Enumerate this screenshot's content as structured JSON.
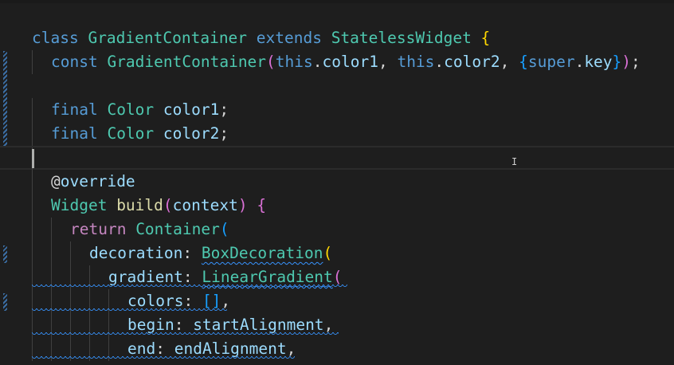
{
  "editor": {
    "lines": [
      {
        "tokens": [
          {
            "c": "k",
            "t": "class "
          },
          {
            "c": "t",
            "t": "GradientContainer "
          },
          {
            "c": "k",
            "t": "extends "
          },
          {
            "c": "t",
            "t": "StatelessWidget "
          },
          {
            "c": "b1",
            "t": "{"
          }
        ]
      },
      {
        "tokens": [
          {
            "c": "k",
            "t": "const "
          },
          {
            "c": "t",
            "t": "GradientContainer"
          },
          {
            "c": "b2",
            "t": "("
          },
          {
            "c": "k",
            "t": "this"
          },
          {
            "c": "p",
            "t": "."
          },
          {
            "c": "v",
            "t": "color1"
          },
          {
            "c": "p",
            "t": ", "
          },
          {
            "c": "k",
            "t": "this"
          },
          {
            "c": "p",
            "t": "."
          },
          {
            "c": "v",
            "t": "color2"
          },
          {
            "c": "p",
            "t": ", "
          },
          {
            "c": "b3",
            "t": "{"
          },
          {
            "c": "k",
            "t": "super"
          },
          {
            "c": "p",
            "t": "."
          },
          {
            "c": "v",
            "t": "key"
          },
          {
            "c": "b3",
            "t": "}"
          },
          {
            "c": "b2",
            "t": ")"
          },
          {
            "c": "p",
            "t": ";"
          }
        ]
      },
      {
        "tokens": []
      },
      {
        "tokens": [
          {
            "c": "k",
            "t": "final "
          },
          {
            "c": "t",
            "t": "Color "
          },
          {
            "c": "v",
            "t": "color1"
          },
          {
            "c": "p",
            "t": ";"
          }
        ]
      },
      {
        "tokens": [
          {
            "c": "k",
            "t": "final "
          },
          {
            "c": "t",
            "t": "Color "
          },
          {
            "c": "v",
            "t": "color2"
          },
          {
            "c": "p",
            "t": ";"
          }
        ]
      },
      {
        "tokens": []
      },
      {
        "tokens": [
          {
            "c": "p",
            "t": "@"
          },
          {
            "c": "v",
            "t": "override"
          }
        ]
      },
      {
        "tokens": [
          {
            "c": "t",
            "t": "Widget "
          },
          {
            "c": "f",
            "t": "build"
          },
          {
            "c": "b2",
            "t": "("
          },
          {
            "c": "v",
            "t": "context"
          },
          {
            "c": "b2",
            "t": ")"
          },
          {
            "c": "p",
            "t": " "
          },
          {
            "c": "b2",
            "t": "{"
          }
        ]
      },
      {
        "tokens": [
          {
            "c": "kp",
            "t": "return "
          },
          {
            "c": "t",
            "t": "Container"
          },
          {
            "c": "b3",
            "t": "("
          }
        ]
      },
      {
        "tokens": [
          {
            "c": "v",
            "t": "decoration"
          },
          {
            "c": "p",
            "t": ": "
          },
          {
            "c": "t squig",
            "t": "BoxDecoration"
          },
          {
            "c": "b1",
            "t": "("
          }
        ]
      },
      {
        "tokens": [
          {
            "c": "v",
            "t": "gradient"
          },
          {
            "c": "p",
            "t": ": "
          },
          {
            "c": "t squig",
            "t": "LinearGradient"
          },
          {
            "c": "b2",
            "t": "("
          }
        ]
      },
      {
        "tokens": [
          {
            "c": "v",
            "t": "colors"
          },
          {
            "c": "p",
            "t": ": "
          },
          {
            "c": "b3",
            "t": "[]"
          },
          {
            "c": "p",
            "t": ","
          }
        ]
      },
      {
        "tokens": [
          {
            "c": "v",
            "t": "begin"
          },
          {
            "c": "p",
            "t": ": "
          },
          {
            "c": "v",
            "t": "startAlignment"
          },
          {
            "c": "p",
            "t": ","
          }
        ]
      },
      {
        "tokens": [
          {
            "c": "v",
            "t": "end"
          },
          {
            "c": "p",
            "t": ": "
          },
          {
            "c": "v",
            "t": "endAlignment"
          },
          {
            "c": "p",
            "t": ","
          }
        ]
      }
    ]
  }
}
